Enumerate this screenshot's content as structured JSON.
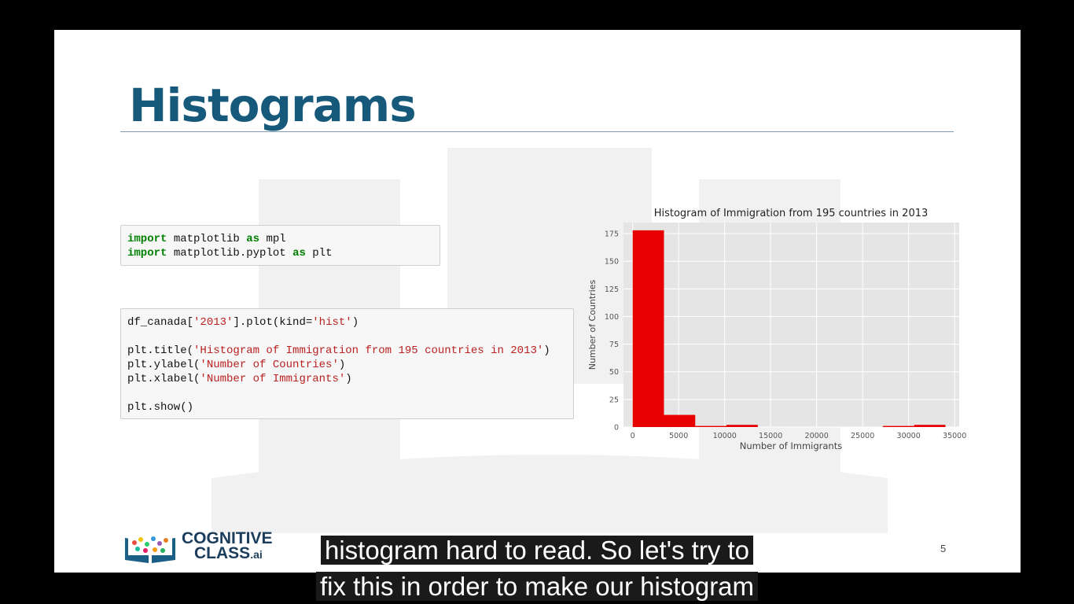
{
  "slide": {
    "title": "Histograms",
    "page_number": "5"
  },
  "code_cells": [
    {
      "lines": [
        [
          {
            "t": "import",
            "c": "kw"
          },
          {
            "t": " matplotlib "
          },
          {
            "t": "as",
            "c": "kw"
          },
          {
            "t": " mpl"
          }
        ],
        [
          {
            "t": "import",
            "c": "kw"
          },
          {
            "t": " matplotlib.pyplot "
          },
          {
            "t": "as",
            "c": "kw"
          },
          {
            "t": " plt"
          }
        ]
      ]
    },
    {
      "lines": [
        [
          {
            "t": "df_canada["
          },
          {
            "t": "'2013'",
            "c": "str"
          },
          {
            "t": "].plot(kind="
          },
          {
            "t": "'hist'",
            "c": "str"
          },
          {
            "t": ")"
          }
        ],
        [],
        [
          {
            "t": "plt.title("
          },
          {
            "t": "'Histogram of Immigration from 195 countries in 2013'",
            "c": "str"
          },
          {
            "t": ")"
          }
        ],
        [
          {
            "t": "plt.ylabel("
          },
          {
            "t": "'Number of Countries'",
            "c": "str"
          },
          {
            "t": ")"
          }
        ],
        [
          {
            "t": "plt.xlabel("
          },
          {
            "t": "'Number of Immigrants'",
            "c": "str"
          },
          {
            "t": ")"
          }
        ],
        [],
        [
          {
            "t": "plt.show()"
          }
        ]
      ]
    }
  ],
  "chart_data": {
    "type": "bar",
    "title": "Histogram of Immigration from 195 countries in 2013",
    "xlabel": "Number of Immigrants",
    "ylabel": "Number of Countries",
    "xlim": [
      -1000,
      35500
    ],
    "ylim": [
      0,
      185
    ],
    "xticks": [
      0,
      5000,
      10000,
      15000,
      20000,
      25000,
      30000,
      35000
    ],
    "yticks": [
      0,
      25,
      50,
      75,
      100,
      125,
      150,
      175
    ],
    "bins": [
      {
        "start": 0,
        "end": 3400,
        "count": 178
      },
      {
        "start": 3400,
        "end": 6800,
        "count": 11
      },
      {
        "start": 6800,
        "end": 10200,
        "count": 1
      },
      {
        "start": 10200,
        "end": 13600,
        "count": 2
      },
      {
        "start": 13600,
        "end": 17000,
        "count": 0
      },
      {
        "start": 17000,
        "end": 20400,
        "count": 0
      },
      {
        "start": 20400,
        "end": 23800,
        "count": 0
      },
      {
        "start": 23800,
        "end": 27200,
        "count": 0
      },
      {
        "start": 27200,
        "end": 30600,
        "count": 1
      },
      {
        "start": 30600,
        "end": 34000,
        "count": 2
      }
    ],
    "bar_color": "#e60000",
    "background": "#e5e5e5",
    "grid": true
  },
  "logo": {
    "line1": "COGNITIVE",
    "line2": "CLASS",
    "suffix": ".ai"
  },
  "captions": [
    "histogram hard to read. So let's try to",
    "fix this in order to make our histogram"
  ]
}
